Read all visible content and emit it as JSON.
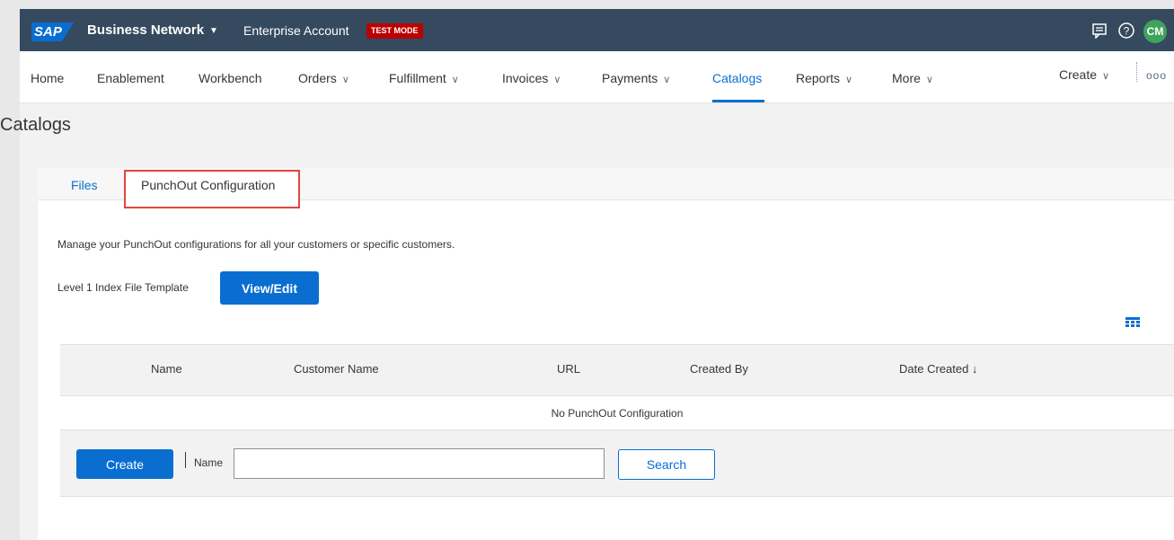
{
  "shell": {
    "logo": "SAP",
    "product": "Business Network",
    "account": "Enterprise Account",
    "badge": "TEST MODE",
    "avatar_initials": "CM",
    "badge_color": "#bb0000",
    "bar_color": "#354a5f"
  },
  "nav": {
    "items": [
      {
        "label": "Home"
      },
      {
        "label": "Enablement"
      },
      {
        "label": "Workbench"
      },
      {
        "label": "Orders"
      },
      {
        "label": "Fulfillment"
      },
      {
        "label": "Invoices"
      },
      {
        "label": "Payments"
      },
      {
        "label": "Catalogs"
      },
      {
        "label": "Reports"
      },
      {
        "label": "More"
      }
    ],
    "active": "Catalogs",
    "create_label": "Create",
    "more_icon": "ooo"
  },
  "page": {
    "title": "Catalogs"
  },
  "tabs": [
    {
      "label": "Files"
    },
    {
      "label": "PunchOut Configuration"
    }
  ],
  "content": {
    "description": "Manage your PunchOut configurations for all your customers or specific customers.",
    "template_label": "Level 1 Index File Template",
    "view_edit_label": "View/Edit"
  },
  "table": {
    "columns": [
      "Name",
      "Customer Name",
      "URL",
      "Created By",
      "Date Created ↓"
    ],
    "empty_message": "No PunchOut Configuration"
  },
  "footer": {
    "create_label": "Create",
    "name_label": "Name",
    "name_value": "",
    "search_label": "Search"
  }
}
